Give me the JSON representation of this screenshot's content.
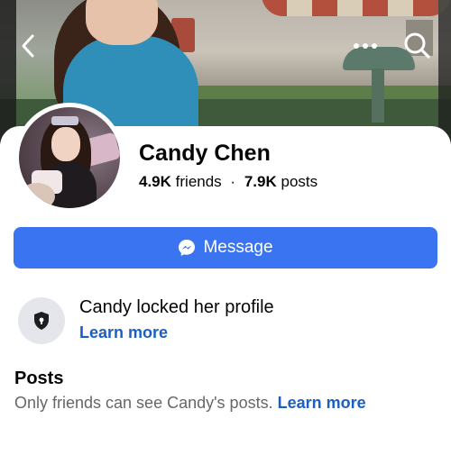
{
  "cover": {
    "icons": {
      "back": "chevron-left-icon",
      "more": "more-horizontal-icon",
      "search": "search-icon"
    }
  },
  "profile": {
    "name": "Candy Chen",
    "friends_count": "4.9K",
    "friends_label": "friends",
    "separator": "·",
    "posts_count": "7.9K",
    "posts_label": "posts"
  },
  "actions": {
    "message_label": "Message",
    "message_icon": "messenger-icon",
    "accent_color": "#3b74f0"
  },
  "locked": {
    "icon": "shield-lock-icon",
    "title": "Candy locked her profile",
    "link": "Learn more",
    "link_color": "#1b5fc6"
  },
  "posts": {
    "heading": "Posts",
    "text": "Only friends can see Candy's posts.",
    "link": "Learn more"
  }
}
